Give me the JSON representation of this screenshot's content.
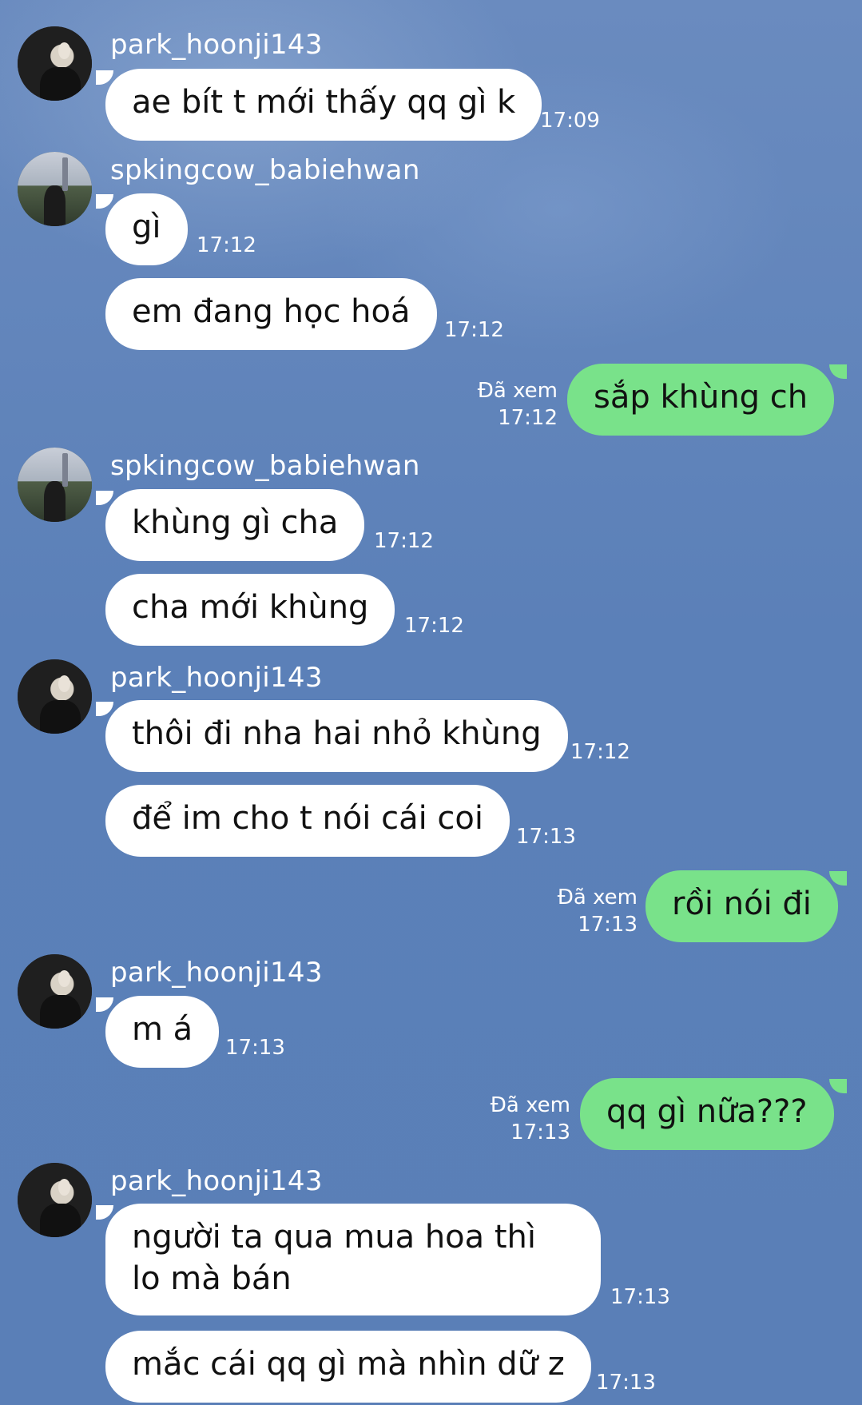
{
  "messages": [
    {
      "sender": "park_hoonji143",
      "text": "ae bít t mới thấy qq gì k",
      "time": "17:09"
    },
    {
      "sender": "spkingcow_babiehwan",
      "text": "gì",
      "time": "17:12"
    },
    {
      "text": "em đang học hoá",
      "time": "17:12"
    },
    {
      "outgoing": true,
      "text": "sắp khùng ch",
      "read": "Đã xem",
      "time": "17:12"
    },
    {
      "sender": "spkingcow_babiehwan",
      "text": "khùng gì cha",
      "time": "17:12"
    },
    {
      "text": "cha mới khùng",
      "time": "17:12"
    },
    {
      "sender": "park_hoonji143",
      "text": "thôi đi nha hai nhỏ khùng",
      "time": "17:12"
    },
    {
      "text": "để im cho t nói cái coi",
      "time": "17:13"
    },
    {
      "outgoing": true,
      "text": "rồi nói đi",
      "read": "Đã xem",
      "time": "17:13"
    },
    {
      "sender": "park_hoonji143",
      "text": "m á",
      "time": "17:13"
    },
    {
      "outgoing": true,
      "text": "qq gì nữa???",
      "read": "Đã xem",
      "time": "17:13"
    },
    {
      "sender": "park_hoonji143",
      "text": "người ta qua mua hoa thì lo mà bán",
      "time": "17:13"
    },
    {
      "text": "mắc cái qq gì mà nhìn dữ z",
      "time": "17:13"
    }
  ],
  "colors": {
    "background": "#5f82b6",
    "incoming_bubble": "#ffffff",
    "outgoing_bubble": "#79e28a"
  }
}
